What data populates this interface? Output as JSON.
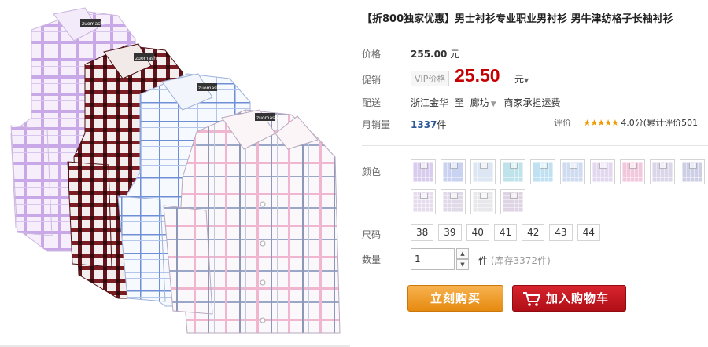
{
  "product": {
    "title": "【折800独家优惠】男士衬衫专业职业男衬衫 男牛津纺格子长袖衬衫",
    "brand_tag": "zuomashi"
  },
  "price": {
    "label": "价格",
    "original": "255.00",
    "original_unit": "元"
  },
  "promo": {
    "label": "促销",
    "tag": "VIP价格",
    "price": "25.50",
    "unit": "元"
  },
  "shipping": {
    "label": "配送",
    "from": "浙江金华",
    "to_prefix": "至",
    "to": "廊坊",
    "fee_note": "商家承担运费"
  },
  "sales": {
    "label": "月销量",
    "count": "1337",
    "unit": "件"
  },
  "rating": {
    "label": "评价",
    "stars": "★★★★★",
    "score_text": "4.0分(累计评价501"
  },
  "color": {
    "label": "颜色",
    "swatches": [
      "#d9ccef",
      "#c9d3f1",
      "#dde6f3",
      "#bfe3ea",
      "#bfe1f2",
      "#cfdbee",
      "#e3d8ef",
      "#f2c9dc",
      "#dcd6ea",
      "#cccfe6",
      "#e6dced",
      "#e0d9e8",
      "#e8e8ec",
      "#ded4e4"
    ]
  },
  "size": {
    "label": "尺码",
    "options": [
      "38",
      "39",
      "40",
      "41",
      "42",
      "43",
      "44"
    ]
  },
  "quantity": {
    "label": "数量",
    "value": "1",
    "unit": "件",
    "stock": "(库存3372件)"
  },
  "actions": {
    "buy_now": "立刻购买",
    "add_to_cart": "加入购物车"
  },
  "colors": {
    "accent_red": "#c40000",
    "buy_orange": "#e68a10",
    "cart_red": "#b00f17"
  }
}
